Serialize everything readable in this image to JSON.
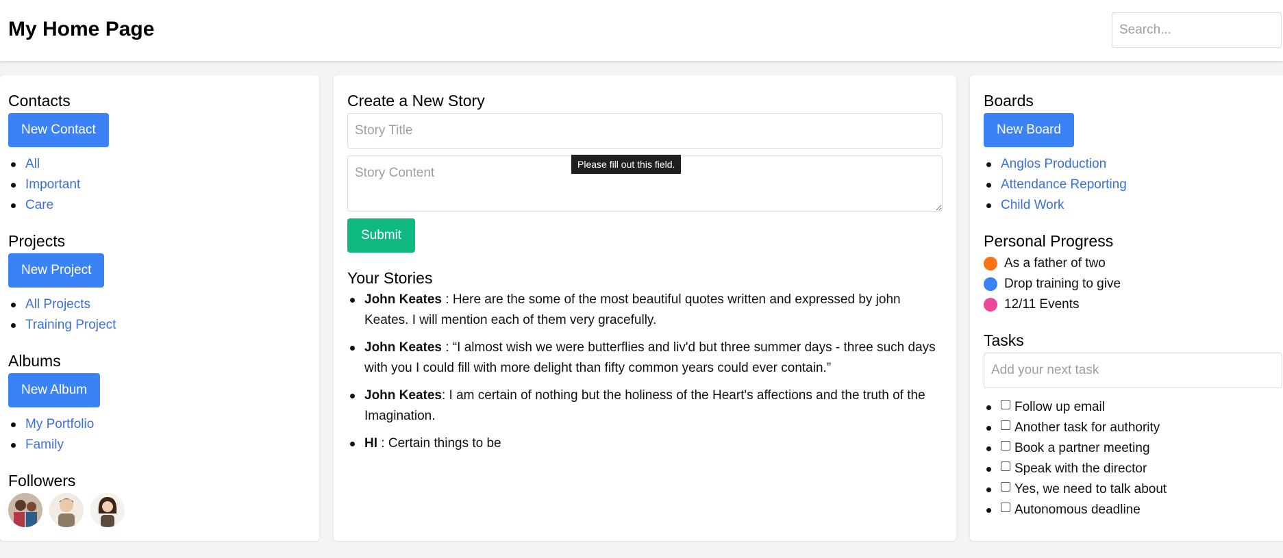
{
  "header": {
    "title": "My Home Page",
    "search_placeholder": "Search..."
  },
  "contacts": {
    "heading": "Contacts",
    "button": "New Contact",
    "items": [
      "All",
      "Important",
      "Care"
    ]
  },
  "projects": {
    "heading": "Projects",
    "button": "New Project",
    "items": [
      "All Projects",
      "Training Project"
    ]
  },
  "albums": {
    "heading": "Albums",
    "button": "New Album",
    "items": [
      "My Portfolio",
      "Family"
    ]
  },
  "followers": {
    "heading": "Followers",
    "avatars": [
      "avatar-1",
      "avatar-2",
      "avatar-3"
    ]
  },
  "story_form": {
    "heading": "Create a New Story",
    "title_placeholder": "Story Title",
    "content_placeholder": "Story Content",
    "tooltip": "Please fill out this field.",
    "submit": "Submit"
  },
  "stories": {
    "heading": "Your Stories",
    "items": [
      {
        "author": "John Keates",
        "sep": " : ",
        "text": "Here are the some of the most beautiful quotes written and expressed by john Keates. I will mention each of them very gracefully."
      },
      {
        "author": "John Keates",
        "sep": " : ",
        "text": "“I almost wish we were butterflies and liv'd but three summer days - three such days with you I could fill with more delight than fifty common years could ever contain.”"
      },
      {
        "author": "John Keates",
        "sep": ": ",
        "text": "I am certain of nothing but the holiness of the Heart's affections and the truth of the Imagination."
      },
      {
        "author": "HI",
        "sep": " : ",
        "text": "Certain things to be"
      }
    ]
  },
  "boards": {
    "heading": "Boards",
    "button": "New Board",
    "items": [
      "Anglos Production",
      "Attendance Reporting",
      "Child Work"
    ]
  },
  "personal_progress": {
    "heading": "Personal Progress",
    "items": [
      {
        "label": "As a father of two",
        "color": "#f97316"
      },
      {
        "label": "Drop training to give",
        "color": "#3b82f6"
      },
      {
        "label": "12/11 Events",
        "color": "#ec4899"
      }
    ]
  },
  "tasks": {
    "heading": "Tasks",
    "input_placeholder": "Add your next task",
    "items": [
      "Follow up email",
      "Another task for authority",
      "Book a partner meeting",
      "Speak with the director",
      "Yes, we need to talk about",
      "Autonomous deadline"
    ]
  },
  "colors": {
    "primary": "#3b82f6",
    "success": "#10b981",
    "link": "#3b6fe0",
    "background": "#f3f4f6"
  }
}
